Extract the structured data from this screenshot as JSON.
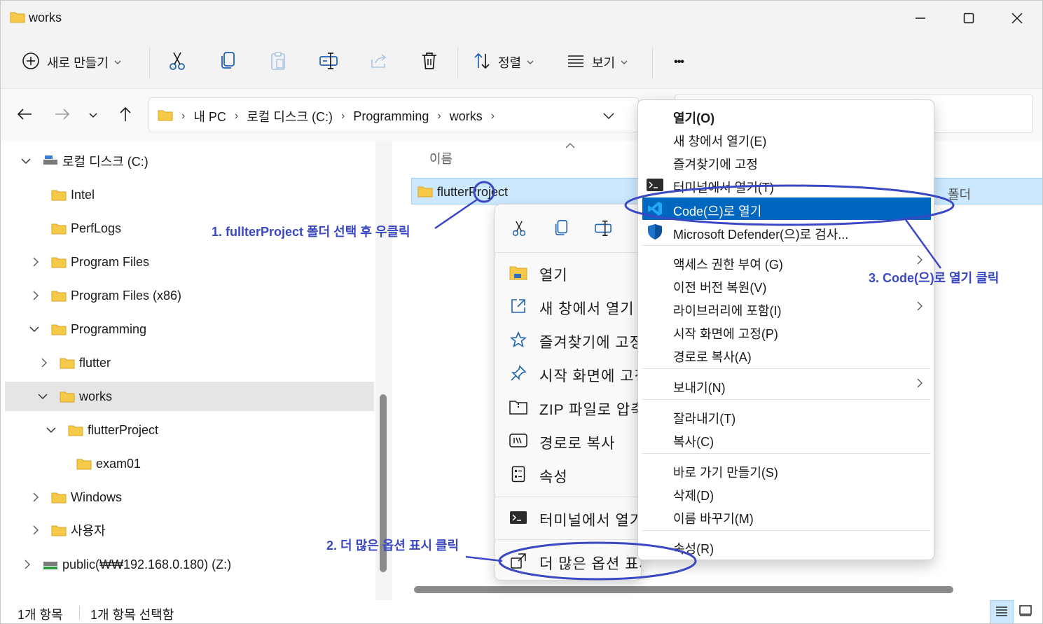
{
  "window": {
    "title": "works"
  },
  "toolbar": {
    "new_label": "새로 만들기",
    "sort_label": "정렬",
    "view_label": "보기",
    "more_label": "•••"
  },
  "address": {
    "crumbs": [
      "내 PC",
      "로컬 디스크 (C:)",
      "Programming",
      "works"
    ]
  },
  "nav": {
    "items": [
      {
        "label": "로컬 디스크 (C:)"
      },
      {
        "label": "Intel"
      },
      {
        "label": "PerfLogs"
      },
      {
        "label": "Program Files"
      },
      {
        "label": "Program Files (x86)"
      },
      {
        "label": "Programming"
      },
      {
        "label": "flutter"
      },
      {
        "label": "works"
      },
      {
        "label": "flutterProject"
      },
      {
        "label": "exam01"
      },
      {
        "label": "Windows"
      },
      {
        "label": "사용자"
      },
      {
        "label": "public(₩₩192.168.0.180) (Z:)"
      }
    ]
  },
  "content": {
    "column_name": "이름",
    "file": {
      "name": "flutterProject",
      "type_fragment": "폴더"
    }
  },
  "status": {
    "count": "1개 항목",
    "selected": "1개 항목 선택함"
  },
  "menu_win11": {
    "items": [
      {
        "label": "열기"
      },
      {
        "label": "새 창에서 열기"
      },
      {
        "label": "즐겨찾기에 고정"
      },
      {
        "label": "시작 화면에 고정"
      },
      {
        "label": "ZIP 파일로 압축"
      },
      {
        "label": "경로로 복사"
      },
      {
        "label": "속성"
      },
      {
        "label": "터미널에서 열기"
      },
      {
        "label": "더 많은 옵션 표시"
      }
    ]
  },
  "menu_classic": {
    "items": [
      {
        "label": "열기(O)"
      },
      {
        "label": "새 창에서 열기(E)"
      },
      {
        "label": "즐겨찾기에 고정"
      },
      {
        "label": "터미널에서 열기(T)"
      },
      {
        "label": "Code(으)로 열기"
      },
      {
        "label": "Microsoft Defender(으)로 검사..."
      },
      {
        "label": "액세스 권한 부여 (G)"
      },
      {
        "label": "이전 버전 복원(V)"
      },
      {
        "label": "라이브러리에 포함(I)"
      },
      {
        "label": "시작 화면에 고정(P)"
      },
      {
        "label": "경로로 복사(A)"
      },
      {
        "label": "보내기(N)"
      },
      {
        "label": "잘라내기(T)"
      },
      {
        "label": "복사(C)"
      },
      {
        "label": "바로 가기 만들기(S)"
      },
      {
        "label": "삭제(D)"
      },
      {
        "label": "이름 바꾸기(M)"
      },
      {
        "label": "속성(R)"
      }
    ]
  },
  "annotations": {
    "step1": "1. fullterProject 폴더 선택 후 우클릭",
    "step2": "2. 더 많은 옵션 표시 클릭",
    "step3": "3. Code(으)로 열기 클릭"
  },
  "colors": {
    "accent": "#0067c0",
    "annotation": "#3a48c4",
    "folder": "#f7c948",
    "selection": "#cce8ff"
  }
}
